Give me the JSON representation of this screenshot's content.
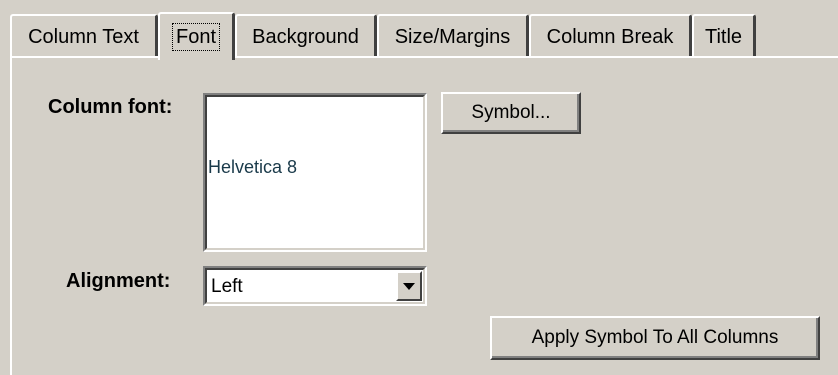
{
  "tabs": [
    {
      "label": "Column Text",
      "active": false
    },
    {
      "label": "Font",
      "active": true
    },
    {
      "label": "Background",
      "active": false
    },
    {
      "label": "Size/Margins",
      "active": false
    },
    {
      "label": "Column Break",
      "active": false
    },
    {
      "label": "Title",
      "active": false
    }
  ],
  "font_section": {
    "label": "Column font:",
    "sample_text": "Helvetica  8"
  },
  "alignment": {
    "label": "Alignment:",
    "value": "Left"
  },
  "buttons": {
    "symbol": "Symbol...",
    "apply_all": "Apply Symbol To All Columns"
  }
}
